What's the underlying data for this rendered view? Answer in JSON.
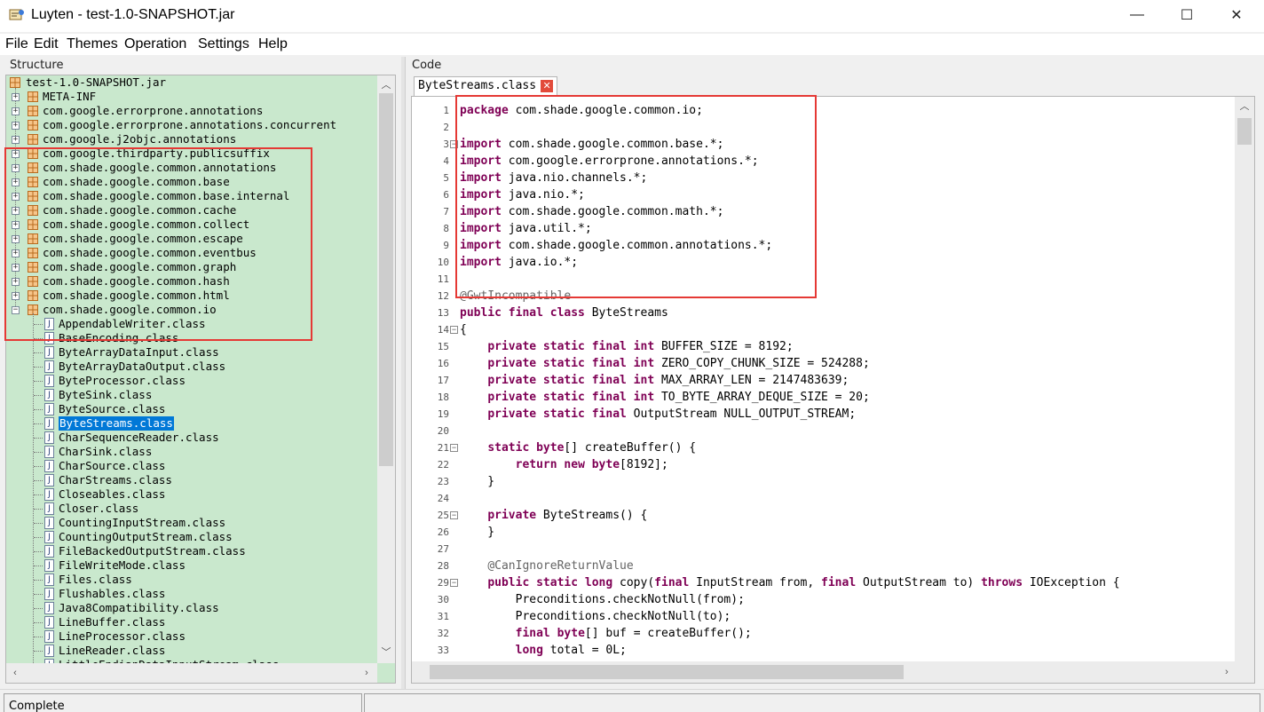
{
  "window": {
    "title": "Luyten - test-1.0-SNAPSHOT.jar",
    "min_glyph": "—",
    "max_glyph": "☐",
    "close_glyph": "✕"
  },
  "menu": [
    "File",
    "Edit",
    "Themes",
    "Operation",
    "Settings",
    "Help"
  ],
  "structure": {
    "label": "Structure",
    "root": "test-1.0-SNAPSHOT.jar",
    "packages": [
      "META-INF",
      "com.google.errorprone.annotations",
      "com.google.errorprone.annotations.concurrent",
      "com.google.j2objc.annotations",
      "com.google.thirdparty.publicsuffix",
      "com.shade.google.common.annotations",
      "com.shade.google.common.base",
      "com.shade.google.common.base.internal",
      "com.shade.google.common.cache",
      "com.shade.google.common.collect",
      "com.shade.google.common.escape",
      "com.shade.google.common.eventbus",
      "com.shade.google.common.graph",
      "com.shade.google.common.hash",
      "com.shade.google.common.html",
      "com.shade.google.common.io"
    ],
    "classes": [
      "AppendableWriter.class",
      "BaseEncoding.class",
      "ByteArrayDataInput.class",
      "ByteArrayDataOutput.class",
      "ByteProcessor.class",
      "ByteSink.class",
      "ByteSource.class",
      "ByteStreams.class",
      "CharSequenceReader.class",
      "CharSink.class",
      "CharSource.class",
      "CharStreams.class",
      "Closeables.class",
      "Closer.class",
      "CountingInputStream.class",
      "CountingOutputStream.class",
      "FileBackedOutputStream.class",
      "FileWriteMode.class",
      "Files.class",
      "Flushables.class",
      "Java8Compatibility.class",
      "LineBuffer.class",
      "LineProcessor.class",
      "LineReader.class",
      "LittleEndianDataInputStream.class"
    ],
    "selected_class": "ByteStreams.class",
    "expanded_package": "com.shade.google.common.io",
    "class_icon_glyph": "J"
  },
  "code": {
    "label": "Code",
    "tab_title": "ByteStreams.class",
    "tab_close_glyph": "✕",
    "lines": [
      [
        {
          "t": "package",
          "k": 1
        },
        {
          "t": " com.shade.google.common.io;"
        }
      ],
      [],
      [
        {
          "t": "import",
          "k": 1
        },
        {
          "t": " com.shade.google.common.base.*;"
        }
      ],
      [
        {
          "t": "import",
          "k": 1
        },
        {
          "t": " com.google.errorprone.annotations.*;"
        }
      ],
      [
        {
          "t": "import",
          "k": 1
        },
        {
          "t": " java.nio.channels.*;"
        }
      ],
      [
        {
          "t": "import",
          "k": 1
        },
        {
          "t": " java.nio.*;"
        }
      ],
      [
        {
          "t": "import",
          "k": 1
        },
        {
          "t": " com.shade.google.common.math.*;"
        }
      ],
      [
        {
          "t": "import",
          "k": 1
        },
        {
          "t": " java.util.*;"
        }
      ],
      [
        {
          "t": "import",
          "k": 1
        },
        {
          "t": " com.shade.google.common.annotations.*;"
        }
      ],
      [
        {
          "t": "import",
          "k": 1
        },
        {
          "t": " java.io.*;"
        }
      ],
      [],
      [
        {
          "t": "@GwtIncompatible",
          "a": 1
        }
      ],
      [
        {
          "t": "public final class",
          "k": 1
        },
        {
          "t": " ByteStreams"
        }
      ],
      [
        {
          "t": "{"
        }
      ],
      [
        {
          "t": "    "
        },
        {
          "t": "private static final int",
          "k": 1
        },
        {
          "t": " BUFFER_SIZE = 8192;"
        }
      ],
      [
        {
          "t": "    "
        },
        {
          "t": "private static final int",
          "k": 1
        },
        {
          "t": " ZERO_COPY_CHUNK_SIZE = 524288;"
        }
      ],
      [
        {
          "t": "    "
        },
        {
          "t": "private static final int",
          "k": 1
        },
        {
          "t": " MAX_ARRAY_LEN = 2147483639;"
        }
      ],
      [
        {
          "t": "    "
        },
        {
          "t": "private static final int",
          "k": 1
        },
        {
          "t": " TO_BYTE_ARRAY_DEQUE_SIZE = 20;"
        }
      ],
      [
        {
          "t": "    "
        },
        {
          "t": "private static final",
          "k": 1
        },
        {
          "t": " OutputStream NULL_OUTPUT_STREAM;"
        }
      ],
      [],
      [
        {
          "t": "    "
        },
        {
          "t": "static byte",
          "k": 1
        },
        {
          "t": "[] createBuffer() {"
        }
      ],
      [
        {
          "t": "        "
        },
        {
          "t": "return new byte",
          "k": 1
        },
        {
          "t": "[8192];"
        }
      ],
      [
        {
          "t": "    }"
        }
      ],
      [],
      [
        {
          "t": "    "
        },
        {
          "t": "private",
          "k": 1
        },
        {
          "t": " ByteStreams() {"
        }
      ],
      [
        {
          "t": "    }"
        }
      ],
      [],
      [
        {
          "t": "    "
        },
        {
          "t": "@CanIgnoreReturnValue",
          "a": 1
        }
      ],
      [
        {
          "t": "    "
        },
        {
          "t": "public static long",
          "k": 1
        },
        {
          "t": " copy("
        },
        {
          "t": "final",
          "k": 1
        },
        {
          "t": " InputStream from, "
        },
        {
          "t": "final",
          "k": 1
        },
        {
          "t": " OutputStream to) "
        },
        {
          "t": "throws",
          "k": 1
        },
        {
          "t": " IOException {"
        }
      ],
      [
        {
          "t": "        Preconditions.checkNotNull(from);"
        }
      ],
      [
        {
          "t": "        Preconditions.checkNotNull(to);"
        }
      ],
      [
        {
          "t": "        "
        },
        {
          "t": "final byte",
          "k": 1
        },
        {
          "t": "[] buf = createBuffer();"
        }
      ],
      [
        {
          "t": "        "
        },
        {
          "t": "long",
          "k": 1
        },
        {
          "t": " total = 0L;"
        }
      ]
    ],
    "fold_lines": [
      3,
      14,
      21,
      25,
      29
    ]
  },
  "status": {
    "text": "Complete"
  }
}
